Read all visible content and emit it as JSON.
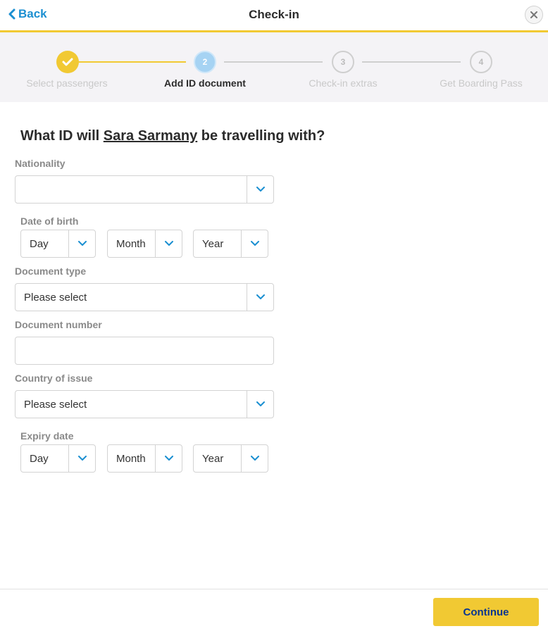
{
  "header": {
    "back_label": "Back",
    "title": "Check-in"
  },
  "stepper": {
    "steps": [
      {
        "number": "1",
        "label": "Select passengers",
        "state": "done"
      },
      {
        "number": "2",
        "label": "Add ID document",
        "state": "active"
      },
      {
        "number": "3",
        "label": "Check-in extras",
        "state": "todo"
      },
      {
        "number": "4",
        "label": "Get Boarding Pass",
        "state": "todo"
      }
    ]
  },
  "form": {
    "question_prefix": "What ID will ",
    "passenger_name": "Sara Sarmany",
    "question_suffix": " be travelling with?",
    "nationality": {
      "label": "Nationality",
      "value": ""
    },
    "date_of_birth": {
      "label": "Date of birth",
      "day": "Day",
      "month": "Month",
      "year": "Year"
    },
    "document_type": {
      "label": "Document type",
      "value": "Please select"
    },
    "document_number": {
      "label": "Document number",
      "value": ""
    },
    "country_of_issue": {
      "label": "Country of issue",
      "value": "Please select"
    },
    "expiry_date": {
      "label": "Expiry date",
      "day": "Day",
      "month": "Month",
      "year": "Year"
    }
  },
  "footer": {
    "continue_label": "Continue"
  },
  "colors": {
    "accent_yellow": "#f1c933",
    "link_blue": "#1b8fd1",
    "button_text": "#073590"
  }
}
